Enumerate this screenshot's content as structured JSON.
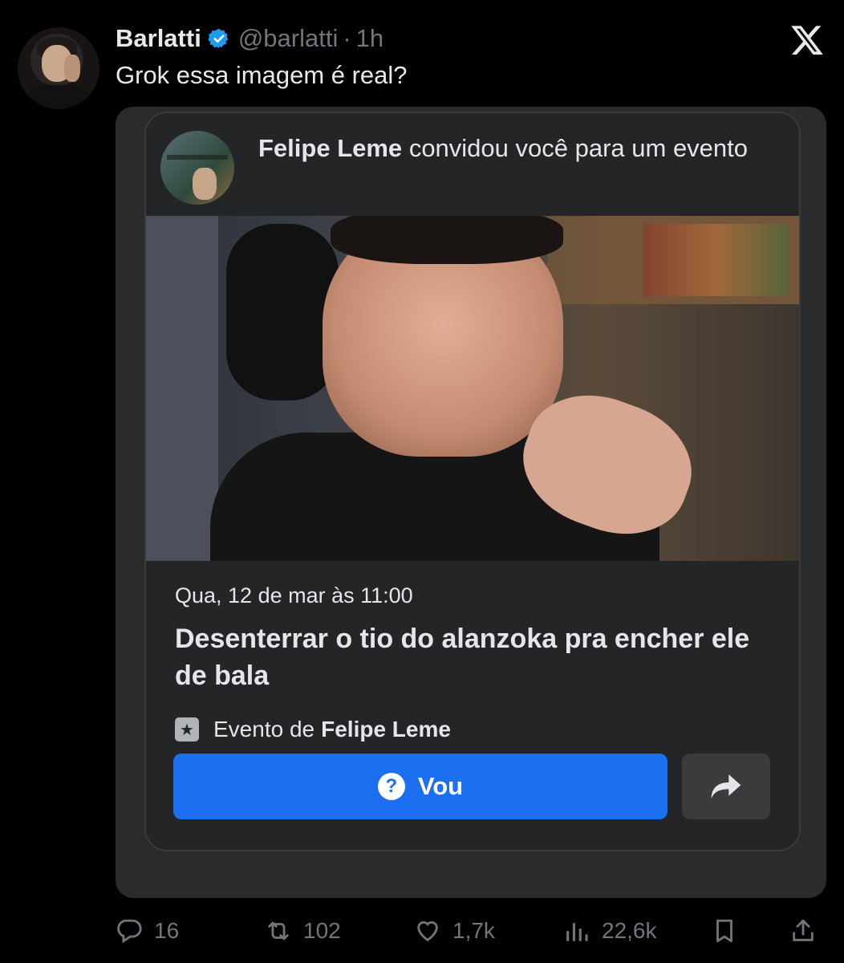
{
  "tweet": {
    "author_name": "Barlatti",
    "handle": "@barlatti",
    "separator": "·",
    "time": "1h",
    "text": "Grok essa imagem é real?"
  },
  "event_card": {
    "inviter_name": "Felipe Leme",
    "invite_message": "convidou você para um evento",
    "date": "Qua, 12 de mar às 11:00",
    "title": "Desenterrar o tio do alanzoka pra encher ele de bala",
    "by_prefix": "Evento de",
    "by_name": "Felipe Leme",
    "rsvp_label": "Vou"
  },
  "metrics": {
    "replies": "16",
    "reposts": "102",
    "likes": "1,7k",
    "views": "22,6k"
  },
  "icons": {
    "verified": "verified-badge-icon",
    "x_logo": "x-logo-icon",
    "reply": "reply-icon",
    "repost": "repost-icon",
    "like": "heart-icon",
    "views": "views-icon",
    "bookmark": "bookmark-icon",
    "share": "share-icon"
  },
  "colors": {
    "background": "#000000",
    "text": "#e7e9ea",
    "muted": "#71767b",
    "verified": "#1d9bf0",
    "fb_blue": "#1b6ff0",
    "card_bg": "#242526"
  }
}
